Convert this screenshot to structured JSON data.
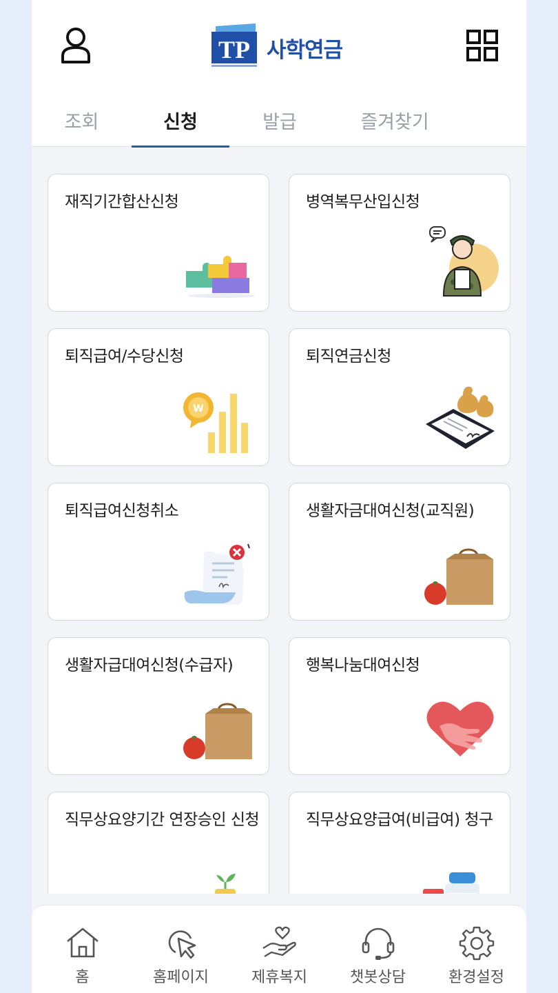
{
  "header": {
    "logo_mark": "TP",
    "logo_text": "사학연금",
    "profile_icon": "user-icon",
    "menu_icon": "grid-menu-icon"
  },
  "tabs": [
    {
      "label": "조회",
      "active": false
    },
    {
      "label": "신청",
      "active": true
    },
    {
      "label": "발급",
      "active": false
    },
    {
      "label": "즐겨찾기",
      "active": false
    }
  ],
  "cards": [
    {
      "label": "재직기간합산신청",
      "icon": "puzzle-icon"
    },
    {
      "label": "병역복무산입신청",
      "icon": "soldier-icon"
    },
    {
      "label": "퇴직급여/수당신청",
      "icon": "coin-bar-chart-icon"
    },
    {
      "label": "퇴직연금신청",
      "icon": "tablet-money-bags-icon"
    },
    {
      "label": "퇴직급여신청취소",
      "icon": "document-cancel-icon"
    },
    {
      "label": "생활자금대여신청(교직원)",
      "icon": "shopping-bag-icon"
    },
    {
      "label": "생활자급대여신청(수급자)",
      "icon": "shopping-bag-icon"
    },
    {
      "label": "행복나눔대여신청",
      "icon": "heart-handshake-icon"
    },
    {
      "label": "직무상요양기간 연장승인 신청",
      "icon": "coin-stacks-icon"
    },
    {
      "label": "직무상요양급여(비급여) 청구",
      "icon": "medicine-bottles-icon"
    }
  ],
  "bottom_nav": [
    {
      "label": "홈",
      "icon": "home-icon"
    },
    {
      "label": "홈페이지",
      "icon": "cursor-click-icon"
    },
    {
      "label": "제휴복지",
      "icon": "hand-heart-icon"
    },
    {
      "label": "챗봇상담",
      "icon": "headset-icon"
    },
    {
      "label": "환경설정",
      "icon": "gear-icon"
    }
  ],
  "colors": {
    "brand_blue": "#1f4fa6",
    "tab_underline": "#1f5ea8",
    "background": "#f2f4f8"
  }
}
